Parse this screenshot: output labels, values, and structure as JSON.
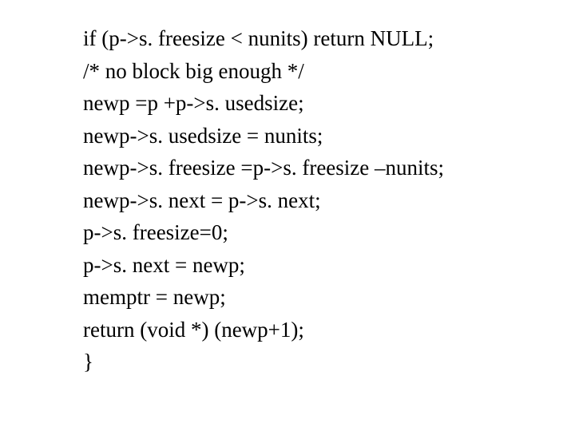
{
  "code": {
    "lines": [
      "if (p->s. freesize < nunits) return NULL;",
      "/* no block big enough */",
      "newp =p +p->s. usedsize;",
      "newp->s. usedsize = nunits;",
      "newp->s. freesize =p->s. freesize –nunits;",
      "newp->s. next = p->s. next;",
      "p->s. freesize=0;",
      "p->s. next = newp;",
      "memptr = newp;",
      "return (void *) (newp+1);",
      "}"
    ]
  }
}
